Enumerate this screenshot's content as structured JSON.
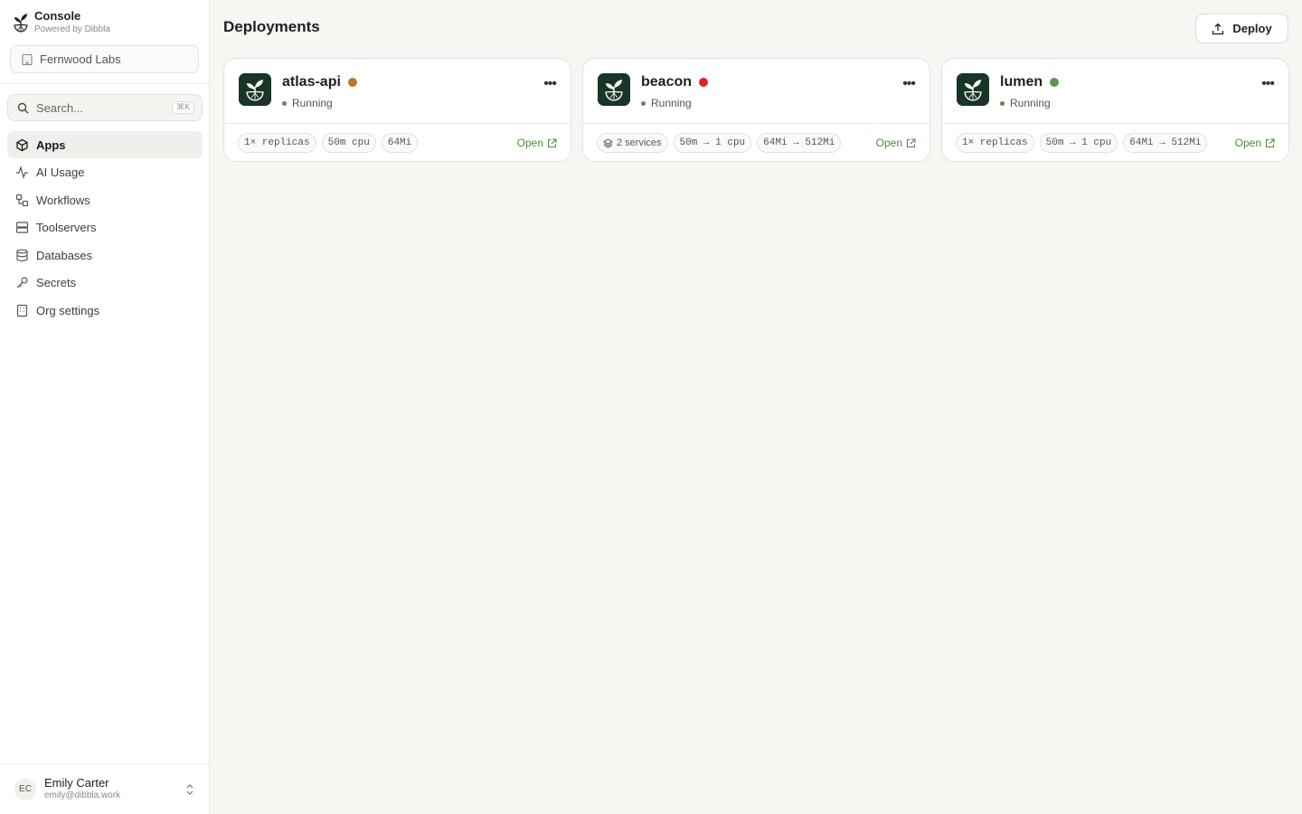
{
  "brand": {
    "title": "Console",
    "subtitle": "Powered by Dibbla"
  },
  "org": {
    "name": "Fernwood Labs"
  },
  "search": {
    "placeholder": "Search...",
    "shortcut": "⌘K"
  },
  "nav": {
    "items": [
      {
        "label": "Apps",
        "icon": "box-icon",
        "active": true
      },
      {
        "label": "AI Usage",
        "icon": "activity-icon"
      },
      {
        "label": "Workflows",
        "icon": "workflow-icon"
      },
      {
        "label": "Toolservers",
        "icon": "server-icon"
      },
      {
        "label": "Databases",
        "icon": "database-icon"
      },
      {
        "label": "Secrets",
        "icon": "key-icon"
      },
      {
        "label": "Org settings",
        "icon": "building-icon"
      }
    ]
  },
  "user": {
    "initials": "EC",
    "name": "Emily Carter",
    "email": "emily@dibbla.work"
  },
  "header": {
    "title": "Deployments",
    "deploy_label": "Deploy"
  },
  "colors": {
    "accent_green": "#4e8a3e",
    "dot_orange": "#c0762a",
    "dot_red": "#e0202e",
    "dot_green": "#5a9a4a"
  },
  "deployments": [
    {
      "name": "atlas-api",
      "dot_color": "#c0762a",
      "status": "Running",
      "chips": [
        "1× replicas",
        "50m cpu",
        "64Mi"
      ],
      "open_label": "Open"
    },
    {
      "name": "beacon",
      "dot_color": "#e0202e",
      "status": "Running",
      "chips": [
        "2 services",
        "50m → 1 cpu",
        "64Mi → 512Mi"
      ],
      "open_label": "Open"
    },
    {
      "name": "lumen",
      "dot_color": "#5a9a4a",
      "status": "Running",
      "chips": [
        "1× replicas",
        "50m → 1 cpu",
        "64Mi → 512Mi"
      ],
      "open_label": "Open"
    }
  ]
}
